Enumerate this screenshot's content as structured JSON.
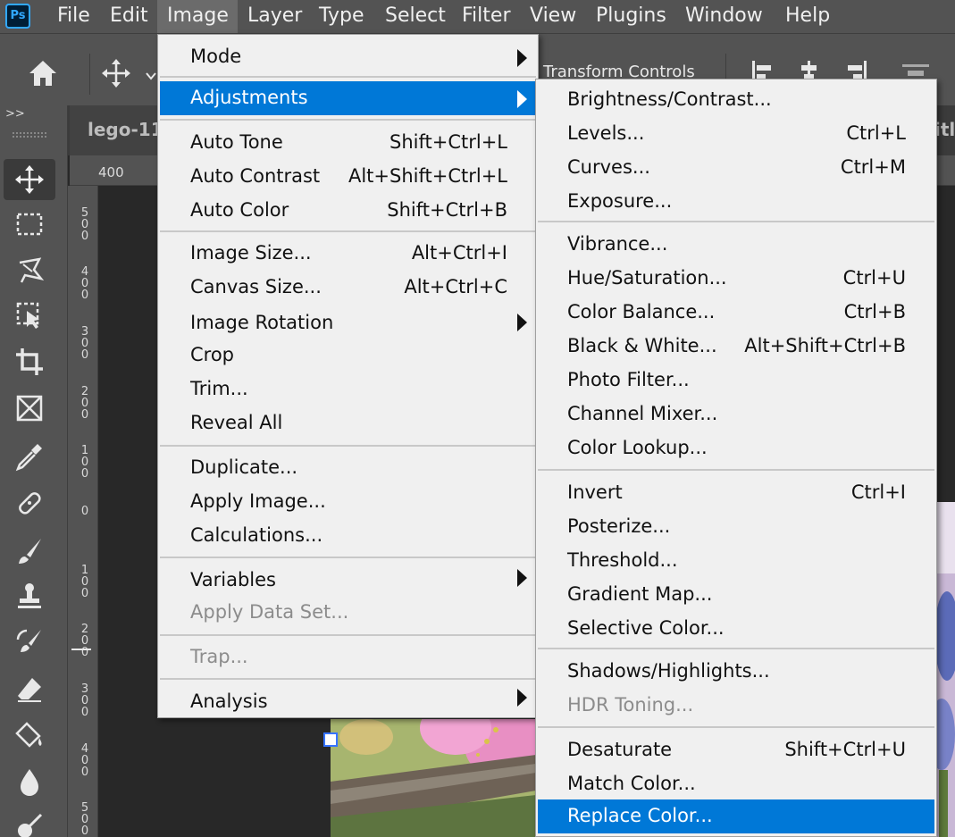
{
  "app": {
    "logo": "Ps"
  },
  "menubar": {
    "items": [
      "File",
      "Edit",
      "Image",
      "Layer",
      "Type",
      "Select",
      "Filter",
      "View",
      "Plugins",
      "Window",
      "Help"
    ],
    "active": "Image"
  },
  "options_bar": {
    "transform_controls_label": "Transform Controls"
  },
  "document": {
    "tab_title": "lego-11",
    "tab_title_right": "itl"
  },
  "ruler": {
    "top_label": "400",
    "left_labels": [
      "5\n0\n0",
      "4\n0\n0",
      "3\n0\n0",
      "2\n0\n0",
      "1\n0\n0",
      "0",
      "1\n0\n0",
      "2\n0\n0",
      "3\n0\n0",
      "4\n0\n0",
      "5\n0\n0"
    ]
  },
  "toolbar": {
    "collapse_glyph": ">>",
    "tools": [
      "move-icon",
      "rectangular-marquee-icon",
      "lasso-icon",
      "object-selection-icon",
      "crop-icon",
      "frame-icon",
      "eyedropper-icon",
      "healing-brush-icon",
      "brush-icon",
      "clone-stamp-icon",
      "history-brush-icon",
      "eraser-icon",
      "paint-bucket-icon",
      "blur-icon",
      "dodge-icon"
    ],
    "selected": "move-icon"
  },
  "image_menu": {
    "items": [
      {
        "label": "Mode",
        "submenu": true
      },
      {
        "label": "Adjustments",
        "submenu": true,
        "highlighted": true
      },
      {
        "label": "Auto Tone",
        "shortcut": "Shift+Ctrl+L"
      },
      {
        "label": "Auto Contrast",
        "shortcut": "Alt+Shift+Ctrl+L"
      },
      {
        "label": "Auto Color",
        "shortcut": "Shift+Ctrl+B"
      },
      {
        "label": "Image Size...",
        "shortcut": "Alt+Ctrl+I"
      },
      {
        "label": "Canvas Size...",
        "shortcut": "Alt+Ctrl+C"
      },
      {
        "label": "Image Rotation",
        "submenu": true
      },
      {
        "label": "Crop"
      },
      {
        "label": "Trim..."
      },
      {
        "label": "Reveal All"
      },
      {
        "label": "Duplicate..."
      },
      {
        "label": "Apply Image..."
      },
      {
        "label": "Calculations..."
      },
      {
        "label": "Variables",
        "submenu": true
      },
      {
        "label": "Apply Data Set...",
        "disabled": true
      },
      {
        "label": "Trap...",
        "disabled": true
      },
      {
        "label": "Analysis",
        "submenu": true
      }
    ]
  },
  "adjustments_menu": {
    "items": [
      {
        "label": "Brightness/Contrast..."
      },
      {
        "label": "Levels...",
        "shortcut": "Ctrl+L"
      },
      {
        "label": "Curves...",
        "shortcut": "Ctrl+M"
      },
      {
        "label": "Exposure..."
      },
      {
        "label": "Vibrance..."
      },
      {
        "label": "Hue/Saturation...",
        "shortcut": "Ctrl+U"
      },
      {
        "label": "Color Balance...",
        "shortcut": "Ctrl+B"
      },
      {
        "label": "Black & White...",
        "shortcut": "Alt+Shift+Ctrl+B"
      },
      {
        "label": "Photo Filter..."
      },
      {
        "label": "Channel Mixer..."
      },
      {
        "label": "Color Lookup..."
      },
      {
        "label": "Invert",
        "shortcut": "Ctrl+I"
      },
      {
        "label": "Posterize..."
      },
      {
        "label": "Threshold..."
      },
      {
        "label": "Gradient Map..."
      },
      {
        "label": "Selective Color..."
      },
      {
        "label": "Shadows/Highlights..."
      },
      {
        "label": "HDR Toning...",
        "disabled": true
      },
      {
        "label": "Desaturate",
        "shortcut": "Shift+Ctrl+U"
      },
      {
        "label": "Match Color..."
      },
      {
        "label": "Replace Color...",
        "highlighted": true
      }
    ]
  },
  "colors": {
    "menu_highlight": "#0078d7",
    "ui_panel": "#535353",
    "canvas_bg": "#282828",
    "menu_bg": "#f0f0f0"
  }
}
